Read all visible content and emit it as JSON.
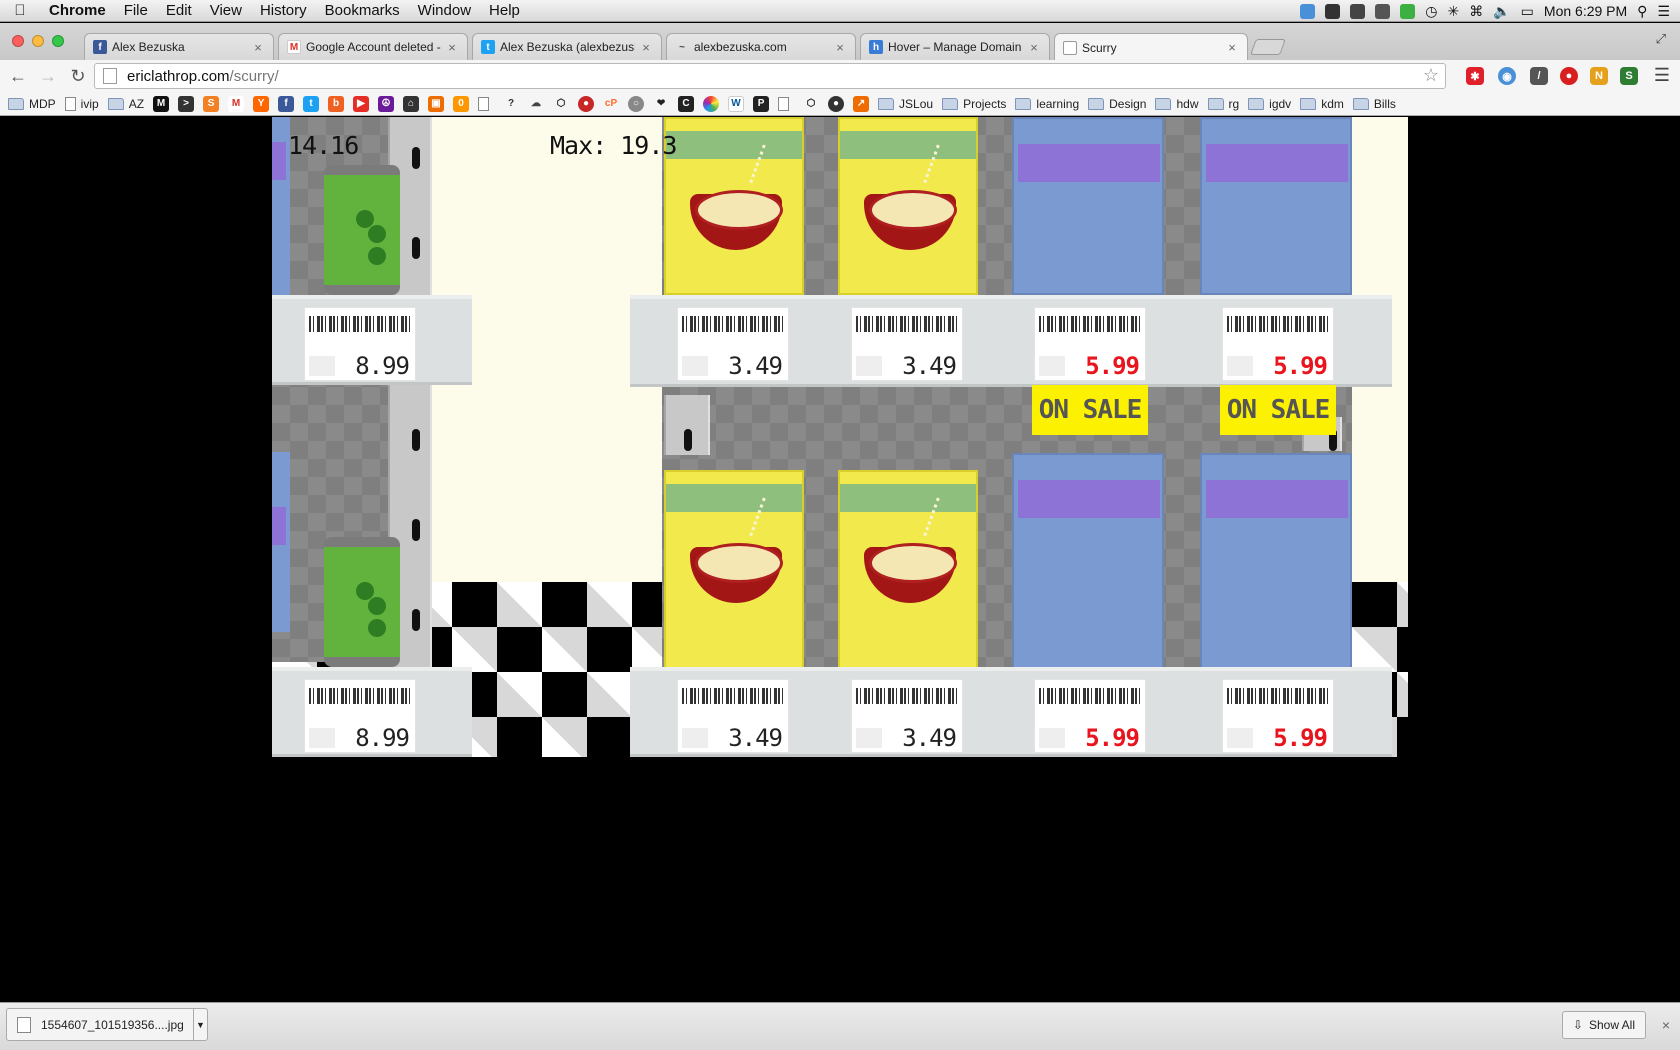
{
  "menubar": {
    "app": "Chrome",
    "items": [
      "File",
      "Edit",
      "View",
      "History",
      "Bookmarks",
      "Window",
      "Help"
    ],
    "clock": "Mon 6:29 PM"
  },
  "tabs": [
    {
      "title": "Alex Bezuska",
      "icon": "facebook-icon",
      "color": "#3b5998"
    },
    {
      "title": "Google Account deleted -",
      "icon": "gmail-icon",
      "color": "#d93025"
    },
    {
      "title": "Alex Bezuska (alexbezuska",
      "icon": "twitter-icon",
      "color": "#1da1f2"
    },
    {
      "title": "alexbezuska.com",
      "icon": "wave-icon",
      "color": "#555555"
    },
    {
      "title": "Hover – Manage Domain D",
      "icon": "hover-icon",
      "color": "#3a7bd5"
    },
    {
      "title": "Scurry",
      "icon": "page-icon",
      "color": "#cccccc"
    }
  ],
  "address": {
    "host": "ericlathrop.com",
    "path": "/scurry/"
  },
  "bookmarks": [
    {
      "type": "folder",
      "label": "MDP"
    },
    {
      "type": "doc",
      "label": "ivip"
    },
    {
      "type": "folder",
      "label": "AZ"
    },
    {
      "type": "icons",
      "label": ""
    },
    {
      "type": "folder",
      "label": "JSLou"
    },
    {
      "type": "folder",
      "label": "Projects"
    },
    {
      "type": "folder",
      "label": "learning"
    },
    {
      "type": "folder",
      "label": "Design"
    },
    {
      "type": "folder",
      "label": "hdw"
    },
    {
      "type": "folder",
      "label": "rg"
    },
    {
      "type": "folder",
      "label": "igdv"
    },
    {
      "type": "folder",
      "label": "kdm"
    },
    {
      "type": "folder",
      "label": "Bills"
    }
  ],
  "game": {
    "score": "14.16",
    "max": "Max: 19.3",
    "prices": {
      "can": "8.99",
      "cereal": "3.49",
      "blue": "5.99"
    },
    "sale_label": "ON SALE"
  },
  "downloads": {
    "file": "1554607_101519356....jpg",
    "show_all": "Show All"
  }
}
